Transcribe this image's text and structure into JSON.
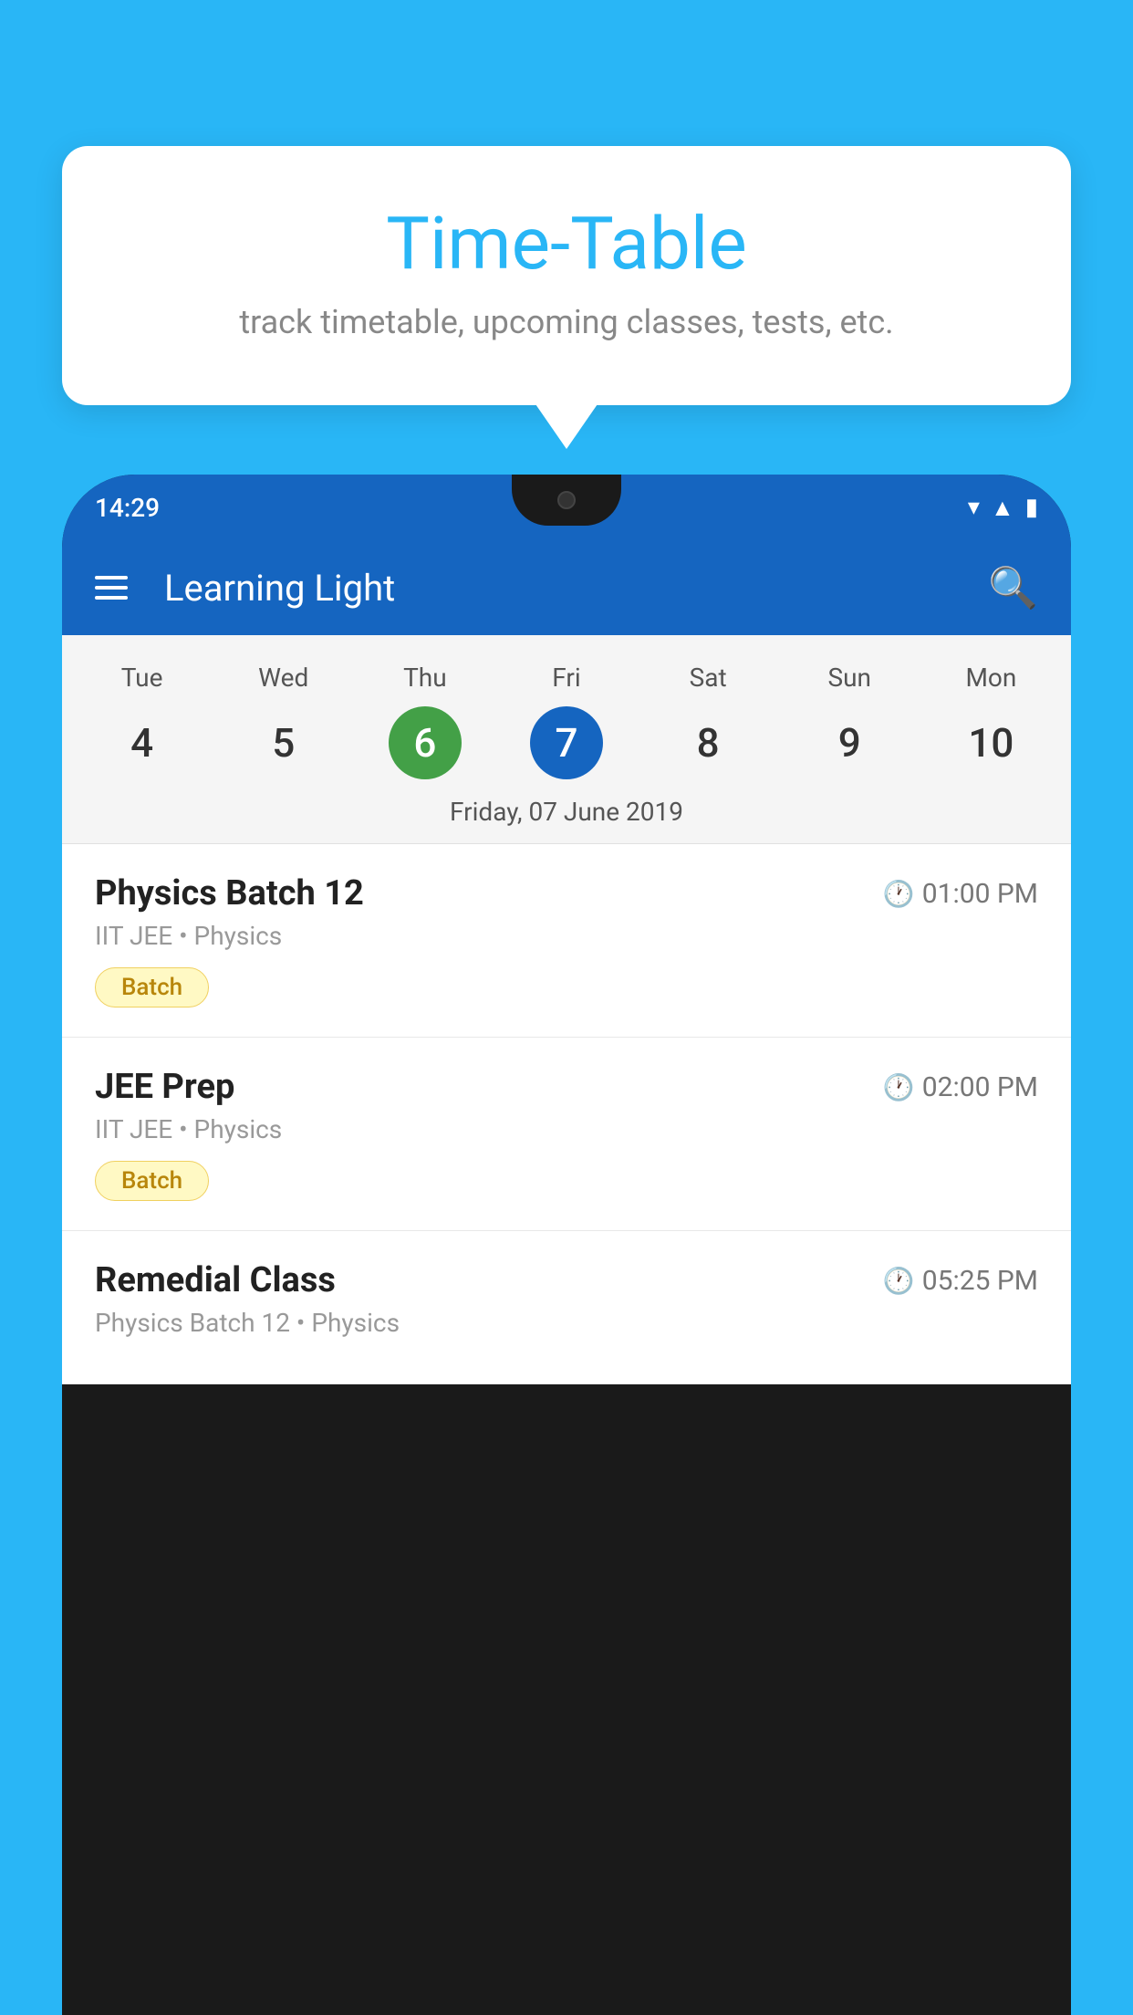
{
  "background_color": "#29B6F6",
  "tooltip": {
    "title": "Time-Table",
    "subtitle": "track timetable, upcoming classes, tests, etc."
  },
  "phone": {
    "status_bar": {
      "time": "14:29"
    },
    "app_bar": {
      "title": "Learning Light"
    },
    "calendar": {
      "days": [
        "Tue",
        "Wed",
        "Thu",
        "Fri",
        "Sat",
        "Sun",
        "Mon"
      ],
      "dates": [
        "4",
        "5",
        "6",
        "7",
        "8",
        "9",
        "10"
      ],
      "today_index": 2,
      "selected_index": 3,
      "selected_date_label": "Friday, 07 June 2019"
    },
    "schedule_items": [
      {
        "title": "Physics Batch 12",
        "time": "01:00 PM",
        "subtitle": "IIT JEE • Physics",
        "badge": "Batch"
      },
      {
        "title": "JEE Prep",
        "time": "02:00 PM",
        "subtitle": "IIT JEE • Physics",
        "badge": "Batch"
      },
      {
        "title": "Remedial Class",
        "time": "05:25 PM",
        "subtitle": "Physics Batch 12 • Physics",
        "badge": null
      }
    ]
  }
}
